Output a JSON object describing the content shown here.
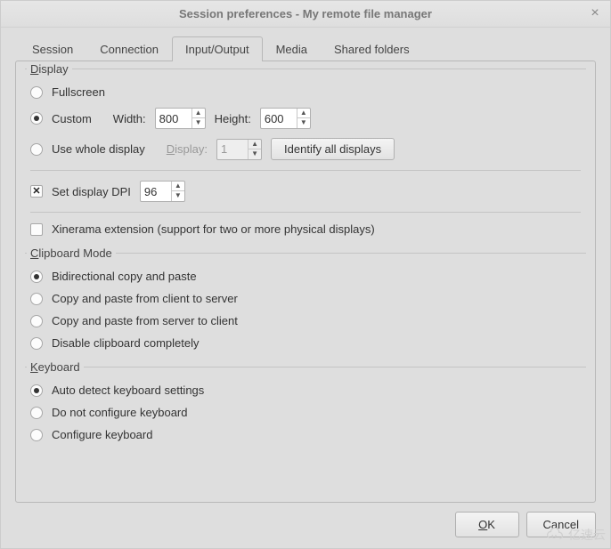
{
  "window": {
    "title": "Session preferences - My remote file manager",
    "close_glyph": "×"
  },
  "tabs": [
    {
      "label": "Session"
    },
    {
      "label": "Connection"
    },
    {
      "label": "Input/Output",
      "active": true
    },
    {
      "label": "Media"
    },
    {
      "label": "Shared folders"
    }
  ],
  "display": {
    "legend_u": "D",
    "legend_rest": "isplay",
    "fullscreen": {
      "label": "Fullscreen",
      "selected": false
    },
    "custom": {
      "label": "Custom",
      "selected": true
    },
    "width_label": "Width:",
    "width_value": "800",
    "height_label": "Height:",
    "height_value": "600",
    "whole": {
      "label": "Use whole display",
      "selected": false
    },
    "display_label_u": "D",
    "display_label_rest": "isplay:",
    "display_value": "1",
    "identify_btn": "Identify all displays",
    "dpi_check": {
      "label": "Set display DPI",
      "checked": true
    },
    "dpi_value": "96",
    "xinerama": {
      "label": "Xinerama extension (support for two or more physical displays)",
      "checked": false
    }
  },
  "clipboard": {
    "legend_u": "C",
    "legend_rest": "lipboard Mode",
    "options": [
      {
        "label": "Bidirectional copy and paste",
        "selected": true
      },
      {
        "label": "Copy and paste from client to server",
        "selected": false
      },
      {
        "label": "Copy and paste from server to client",
        "selected": false
      },
      {
        "label": "Disable clipboard completely",
        "selected": false
      }
    ]
  },
  "keyboard": {
    "legend_u": "K",
    "legend_rest": "eyboard",
    "options": [
      {
        "label": "Auto detect keyboard settings",
        "selected": true
      },
      {
        "label": "Do not configure keyboard",
        "selected": false
      },
      {
        "label": "Configure keyboard",
        "selected": false
      }
    ]
  },
  "footer": {
    "ok_u": "O",
    "ok_rest": "K",
    "cancel": "Cancel"
  },
  "watermark": "亿速云"
}
